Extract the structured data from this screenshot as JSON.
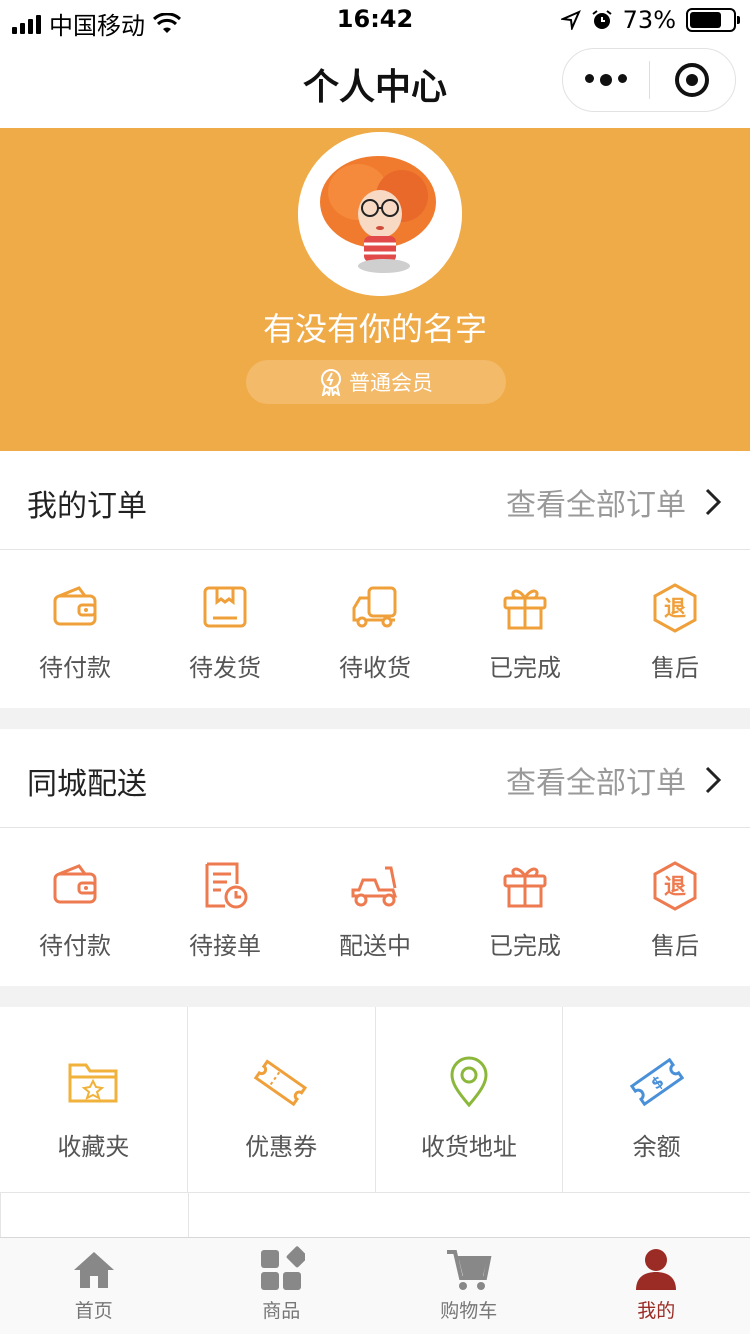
{
  "status_bar": {
    "carrier": "中国移动",
    "time": "16:42",
    "battery": "73%",
    "battery_level": 0.73
  },
  "nav": {
    "title": "个人中心"
  },
  "profile": {
    "name": "有没有你的名字",
    "member_level": "普通会员"
  },
  "orders": {
    "title": "我的订单",
    "more": "查看全部订单",
    "items": [
      {
        "label": "待付款",
        "icon": "wallet-icon"
      },
      {
        "label": "待发货",
        "icon": "package-icon"
      },
      {
        "label": "待收货",
        "icon": "truck-icon"
      },
      {
        "label": "已完成",
        "icon": "gift-icon"
      },
      {
        "label": "售后",
        "icon": "refund-icon"
      }
    ]
  },
  "delivery": {
    "title": "同城配送",
    "more": "查看全部订单",
    "items": [
      {
        "label": "待付款",
        "icon": "wallet-icon"
      },
      {
        "label": "待接单",
        "icon": "receipt-clock-icon"
      },
      {
        "label": "配送中",
        "icon": "scooter-icon"
      },
      {
        "label": "已完成",
        "icon": "gift-icon"
      },
      {
        "label": "售后",
        "icon": "refund-icon"
      }
    ]
  },
  "services": [
    {
      "label": "收藏夹",
      "icon": "favorites-folder-icon"
    },
    {
      "label": "优惠券",
      "icon": "coupon-icon"
    },
    {
      "label": "收货地址",
      "icon": "location-pin-icon"
    },
    {
      "label": "余额",
      "icon": "balance-icon"
    }
  ],
  "tabs": [
    {
      "label": "首页",
      "icon": "home-icon"
    },
    {
      "label": "商品",
      "icon": "products-icon"
    },
    {
      "label": "购物车",
      "icon": "cart-icon"
    },
    {
      "label": "我的",
      "icon": "user-icon",
      "active": true
    }
  ],
  "colors": {
    "header": "#f0ab49",
    "icon_orange": "#f0a03a",
    "icon_coral": "#ee7a4f",
    "icon_green": "#8bb83b",
    "icon_blue": "#4a90d9",
    "tab_active": "#9b2b25"
  }
}
